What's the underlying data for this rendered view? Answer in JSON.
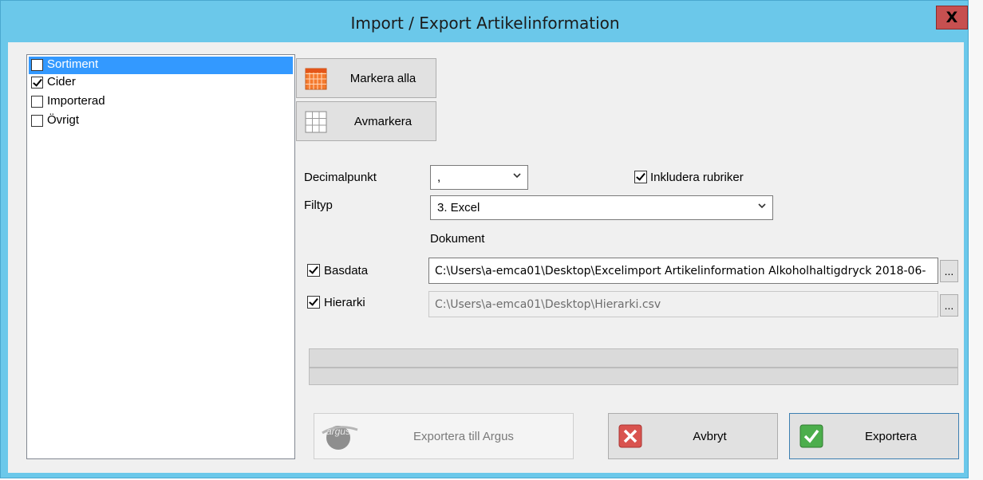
{
  "window": {
    "title": "Import / Export Artikelinformation",
    "close_label": "X"
  },
  "categories": [
    {
      "label": "Sortiment",
      "checked": false,
      "selected": true
    },
    {
      "label": "Cider",
      "checked": true,
      "selected": false
    },
    {
      "label": "Importerad",
      "checked": false,
      "selected": false
    },
    {
      "label": "Övrigt",
      "checked": false,
      "selected": false
    }
  ],
  "buttons": {
    "select_all": "Markera alla",
    "deselect": "Avmarkera",
    "export_argus": "Exportera till Argus",
    "cancel": "Avbryt",
    "export": "Exportera",
    "browse": "..."
  },
  "settings": {
    "decimal_label": "Decimalpunkt",
    "decimal_value": ",",
    "include_headers_label": "Inkludera rubriker",
    "include_headers_checked": true,
    "filetype_label": "Filtyp",
    "filetype_value": "3. Excel",
    "document_heading": "Dokument"
  },
  "documents": {
    "basdata_label": "Basdata",
    "basdata_checked": true,
    "basdata_path": "C:\\Users\\a-emca01\\Desktop\\Excelimport Artikelinformation Alkoholhaltigdryck 2018-06-",
    "hierarki_label": "Hierarki",
    "hierarki_checked": true,
    "hierarki_path": "C:\\Users\\a-emca01\\Desktop\\Hierarki.csv"
  },
  "progress": {
    "upper_value": 0,
    "lower_value": 0
  },
  "argus_logo_text": "argus",
  "colors": {
    "title_bar": "#6bc8ea",
    "close_button": "#c75050",
    "selection": "#3399ff",
    "cancel_icon": "#d9534f",
    "export_icon": "#4cae4c"
  }
}
